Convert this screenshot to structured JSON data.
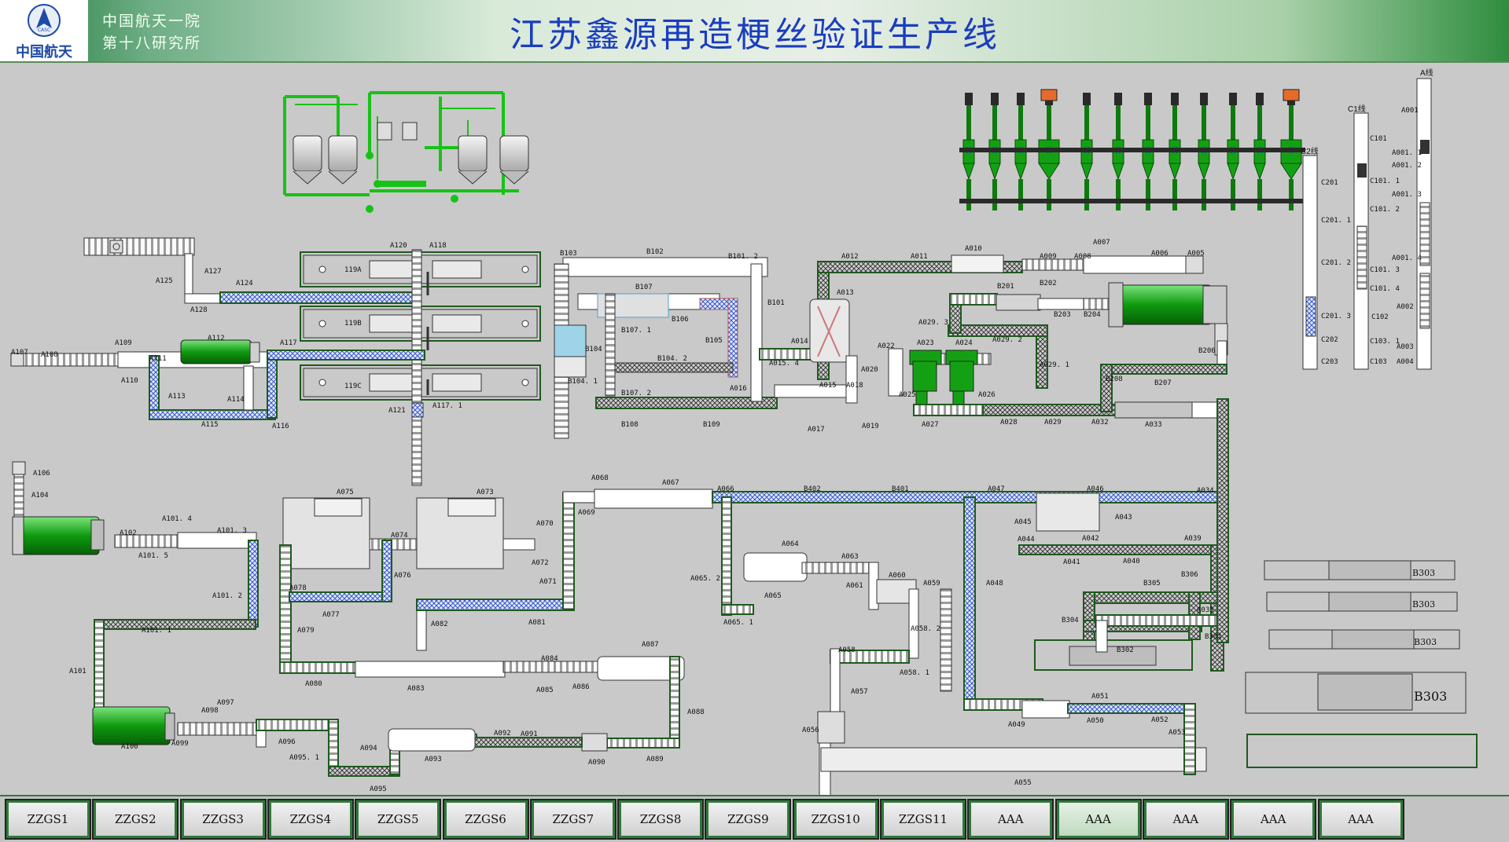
{
  "header": {
    "logo_text": "中国航天",
    "logo_badge": "CASC",
    "org_line1": "中国航天一院",
    "org_line2": "第十八研究所",
    "title": "江苏鑫源再造梗丝验证生产线"
  },
  "labels": {
    "A001": "A001",
    "A001_1": "A001. 1",
    "A001_2": "A001. 2",
    "A001_3": "A001. 3",
    "A001_4": "A001. 4",
    "A002": "A002",
    "A003": "A003",
    "A004": "A004",
    "A005": "A005",
    "A006": "A006",
    "A007": "A007",
    "A008": "A008",
    "A009": "A009",
    "A010": "A010",
    "A011": "A011",
    "A012": "A012",
    "A013": "A013",
    "A014": "A014",
    "A015": "A015",
    "A015_4": "A015. 4",
    "A016": "A016",
    "A017": "A017",
    "A018": "A018",
    "A019": "A019",
    "A020": "A020",
    "A022": "A022",
    "A023": "A023",
    "A024": "A024",
    "A025": "A025",
    "A026": "A026",
    "A027": "A027",
    "A028": "A028",
    "A029": "A029",
    "A029_1": "A029. 1",
    "A029_2": "A029. 2",
    "A029_3": "A029. 3",
    "A032": "A032",
    "A033": "A033",
    "A034": "A034",
    "A035": "A035",
    "A039": "A039",
    "A040": "A040",
    "A041": "A041",
    "A042": "A042",
    "A043": "A043",
    "A044": "A044",
    "A045": "A045",
    "A046": "A046",
    "A047": "A047",
    "A048": "A048",
    "A049": "A049",
    "A050": "A050",
    "A051": "A051",
    "A052": "A052",
    "A053": "A053",
    "A055": "A055",
    "A056": "A056",
    "A057": "A057",
    "A058": "A058",
    "A058_1": "A058. 1",
    "A058_2": "A058. 2",
    "A059": "A059",
    "A060": "A060",
    "A061": "A061",
    "A063": "A063",
    "A064": "A064",
    "A065": "A065",
    "A065_1": "A065. 1",
    "A065_2": "A065. 2",
    "A066": "A066",
    "A067": "A067",
    "A068": "A068",
    "A069": "A069",
    "A070": "A070",
    "A071": "A071",
    "A072": "A072",
    "A073": "A073",
    "A074": "A074",
    "A075": "A075",
    "A076": "A076",
    "A077": "A077",
    "A078": "A078",
    "A079": "A079",
    "A080": "A080",
    "A081": "A081",
    "A082": "A082",
    "A083": "A083",
    "A084": "A084",
    "A085": "A085",
    "A086": "A086",
    "A087": "A087",
    "A088": "A088",
    "A089": "A089",
    "A090": "A090",
    "A091": "A091",
    "A092": "A092",
    "A093": "A093",
    "A094": "A094",
    "A095": "A095",
    "A095_1": "A095. 1",
    "A096": "A096",
    "A097": "A097",
    "A098": "A098",
    "A099": "A099",
    "A100": "A100",
    "A101": "A101",
    "A101_1": "A101. 1",
    "A101_2": "A101. 2",
    "A101_3": "A101. 3",
    "A101_4": "A101. 4",
    "A101_5": "A101. 5",
    "A102": "A102",
    "A104": "A104",
    "A106": "A106",
    "A107": "A107",
    "A108": "A108",
    "A109": "A109",
    "A110": "A110",
    "A111": "A111",
    "A112": "A112",
    "A113": "A113",
    "A114": "A114",
    "A115": "A115",
    "A116": "A116",
    "A117": "A117",
    "A117_1": "A117. 1",
    "A118": "A118",
    "A120": "A120",
    "A121": "A121",
    "A124": "A124",
    "A125": "A125",
    "A127": "A127",
    "A128": "A128",
    "A119A": "119A",
    "A119B": "119B",
    "A119C": "119C",
    "B101": "B101",
    "B101_2": "B101. 2",
    "B102": "B102",
    "B103": "B103",
    "B104": "B104",
    "B104_1": "B104. 1",
    "B104_2": "B104. 2",
    "B105": "B105",
    "B106": "B106",
    "B107": "B107",
    "B107_1": "B107. 1",
    "B107_2": "B107. 2",
    "B108": "B108",
    "B109": "B109",
    "B201": "B201",
    "B202": "B202",
    "B203": "B203",
    "B204": "B204",
    "B206": "B206",
    "B207": "B207",
    "B208": "B208",
    "B301": "B301",
    "B302": "B302",
    "B303": "B303",
    "B304": "B304",
    "B305": "B305",
    "B306": "B306",
    "B401": "B401",
    "B402": "B402",
    "C101": "C101",
    "C101_1": "C101. 1",
    "C101_2": "C101. 2",
    "C101_3": "C101. 3",
    "C101_4": "C101. 4",
    "C102": "C102",
    "C103": "C103",
    "C103_1": "C103. 1",
    "C201": "C201",
    "C201_1": "C201. 1",
    "C201_2": "C201. 2",
    "C201_3": "C201. 3",
    "C202": "C202",
    "C203": "C203",
    "lineA": "A线",
    "lineC1": "C1线",
    "lineC2": "C2线"
  },
  "nav": {
    "buttons": [
      "ZZGS1",
      "ZZGS2",
      "ZZGS3",
      "ZZGS4",
      "ZZGS5",
      "ZZGS6",
      "ZZGS7",
      "ZZGS8",
      "ZZGS9",
      "ZZGS10",
      "ZZGS11",
      "AAA",
      "AAA",
      "AAA",
      "AAA",
      "AAA"
    ],
    "active_index": 12
  },
  "colors": {
    "conveyor_border": "#1e5a1e",
    "mesh": "#3a3a3a",
    "blue_mesh": "#3557c7",
    "tank_green": "#13a113",
    "accent_green": "#2f7a3a",
    "title_blue": "#1a3dbf"
  }
}
